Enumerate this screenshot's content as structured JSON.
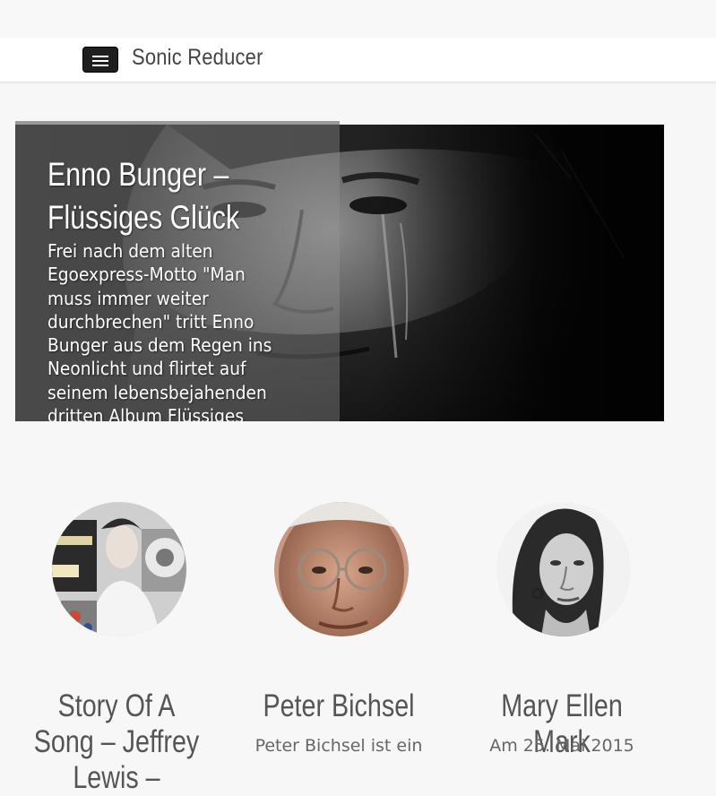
{
  "header": {
    "brand": "Sonic Reducer",
    "menu_icon": "hamburger-menu-icon"
  },
  "hero": {
    "title": "Enno Bunger – Flüssiges Glück",
    "excerpt": "Frei nach dem alten Egoexpress-Motto \"Man muss immer weiter durchbrechen\" tritt Enno Bunger aus dem Regen ins Neonlicht und flirtet auf seinem lebensbejahenden dritten Album Flüssiges",
    "image": "portrait-with-water-photo"
  },
  "cards": [
    {
      "title": "Story Of A Song – Jeffrey Lewis –",
      "excerpt": "",
      "image": "young-man-with-records-photo"
    },
    {
      "title": "Peter Bichsel",
      "excerpt": "Peter Bichsel ist ein",
      "image": "elderly-man-glasses-photo"
    },
    {
      "title": "Mary Ellen Mark",
      "excerpt": "Am 25. Mai 2015",
      "image": "woman-portrait-photo"
    }
  ],
  "colors": {
    "background": "#f7f7f7",
    "navbar": "#ffffff",
    "toggle": "#1f1f1f",
    "text": "#555555"
  }
}
